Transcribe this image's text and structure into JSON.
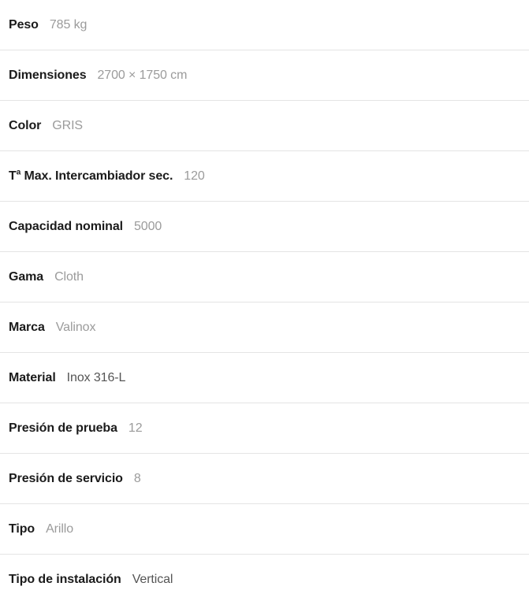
{
  "spec_table": {
    "rows": [
      {
        "label": "Peso",
        "value": "785 kg",
        "tone": "light"
      },
      {
        "label": "Dimensiones",
        "value": "2700 × 1750 cm",
        "tone": "light"
      },
      {
        "label": "Color",
        "value": "GRIS",
        "tone": "light"
      },
      {
        "label": "Tª Max. Intercambiador sec.",
        "value": "120",
        "tone": "light"
      },
      {
        "label": "Capacidad nominal",
        "value": "5000",
        "tone": "light"
      },
      {
        "label": "Gama",
        "value": "Cloth",
        "tone": "light"
      },
      {
        "label": "Marca",
        "value": "Valinox",
        "tone": "light"
      },
      {
        "label": "Material",
        "value": "Inox 316-L",
        "tone": "dark"
      },
      {
        "label": "Presión de prueba",
        "value": "12",
        "tone": "light"
      },
      {
        "label": "Presión de servicio",
        "value": "8",
        "tone": "light"
      },
      {
        "label": "Tipo",
        "value": "Arillo",
        "tone": "light"
      },
      {
        "label": "Tipo de instalación",
        "value": "Vertical",
        "tone": "dark"
      }
    ]
  },
  "colors": {
    "background": "#ffffff",
    "label_text": "#1b1b1b",
    "value_text_light": "#9b9b9b",
    "value_text_dark": "#555555",
    "divider": "#e4e4e4"
  }
}
